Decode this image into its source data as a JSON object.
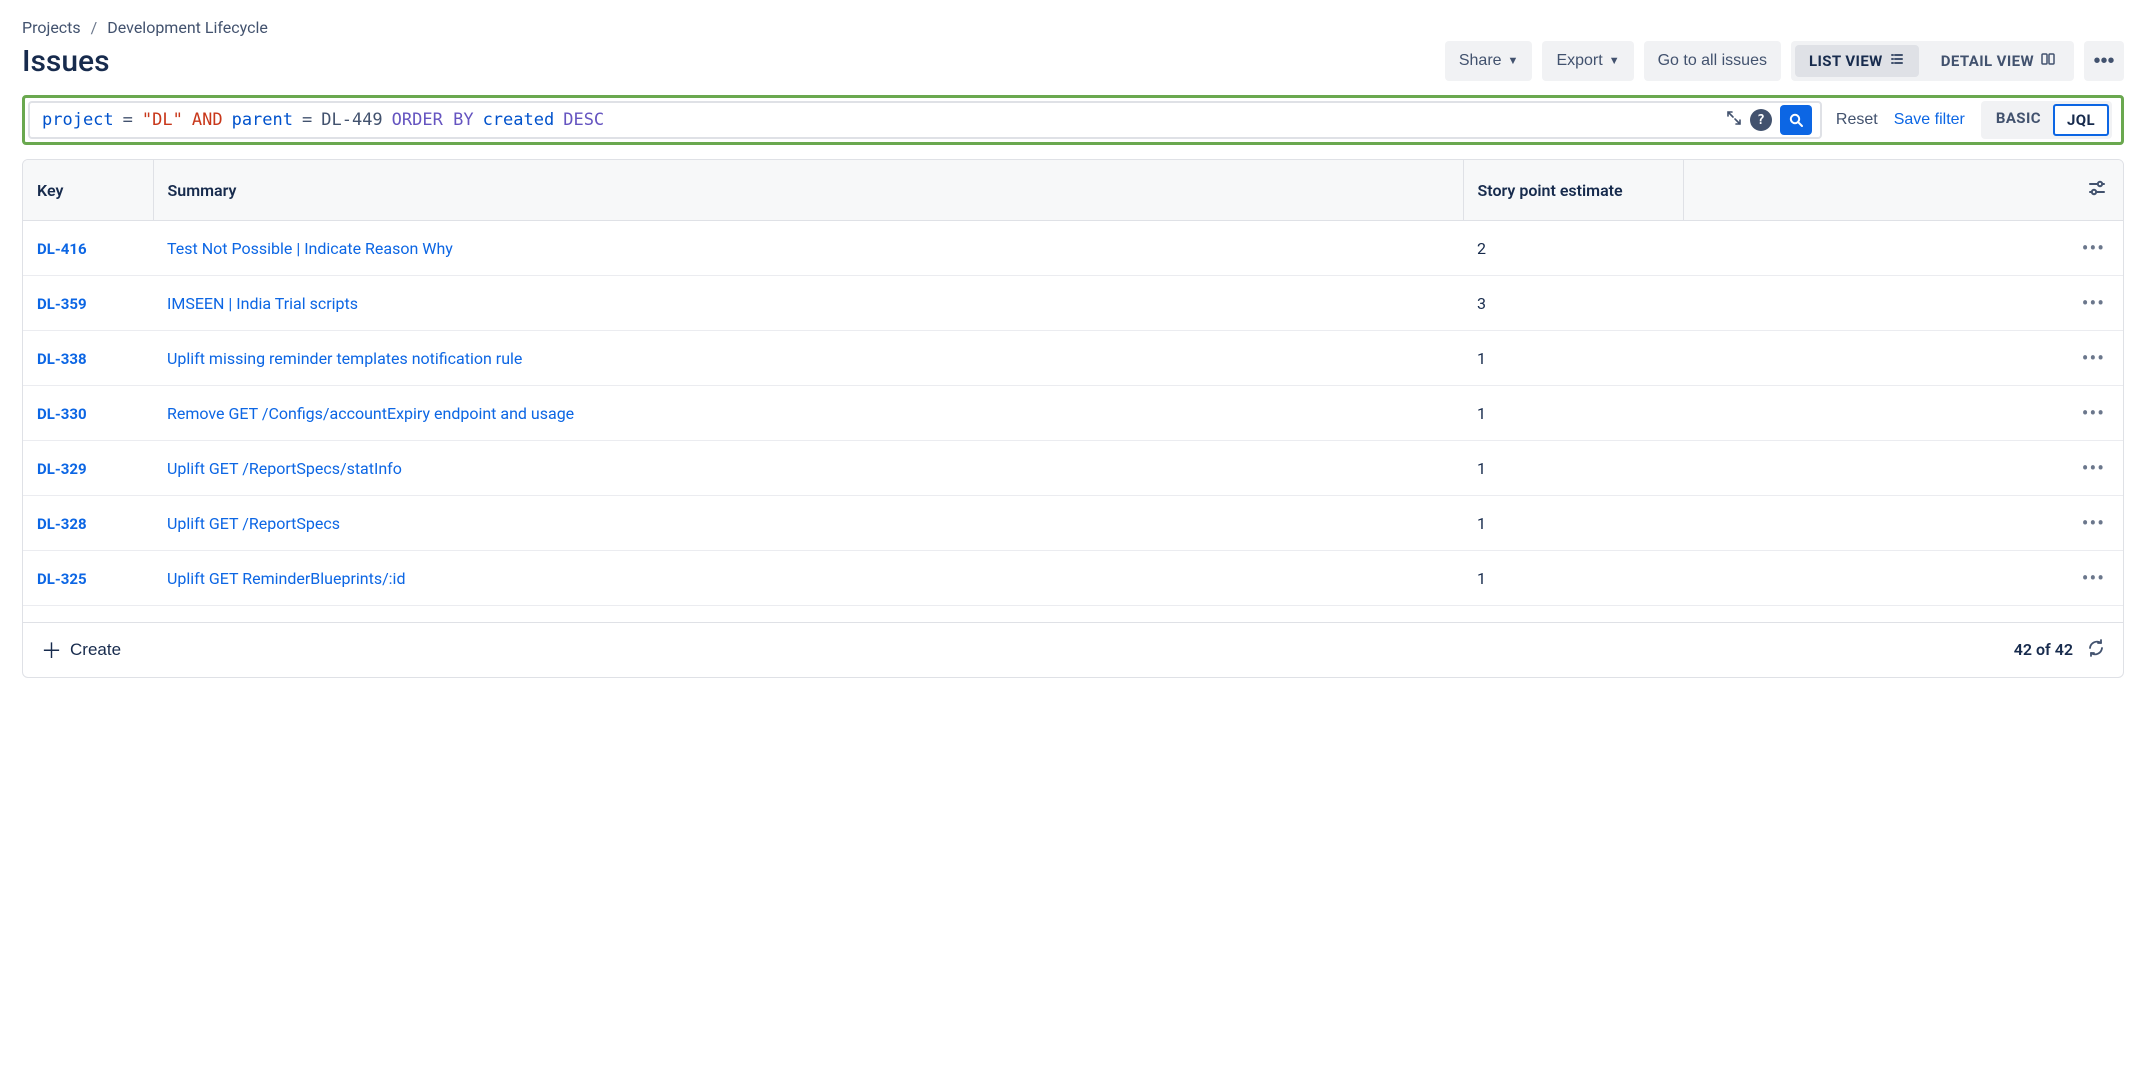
{
  "breadcrumb": {
    "root": "Projects",
    "current": "Development Lifecycle"
  },
  "title": "Issues",
  "header": {
    "share": "Share",
    "export": "Export",
    "go_all": "Go to all issues",
    "list_view": "LIST VIEW",
    "detail_view": "DETAIL VIEW"
  },
  "jql": {
    "t1": "project",
    "t2": "=",
    "t3": "\"DL\"",
    "t4": "AND",
    "t5": "parent",
    "t6": "=",
    "t7": "DL-449",
    "t8": "ORDER BY",
    "t9": "created",
    "t10": "DESC"
  },
  "search_right": {
    "reset": "Reset",
    "save": "Save filter",
    "basic": "BASIC",
    "jql": "JQL"
  },
  "columns": {
    "key": "Key",
    "summary": "Summary",
    "sp": "Story point estimate"
  },
  "rows": [
    {
      "key": "DL-416",
      "summary": "Test Not Possible | Indicate Reason Why",
      "sp": "2"
    },
    {
      "key": "DL-359",
      "summary": "IMSEEN | India Trial scripts",
      "sp": "3"
    },
    {
      "key": "DL-338",
      "summary": "Uplift missing reminder templates notification rule",
      "sp": "1"
    },
    {
      "key": "DL-330",
      "summary": "Remove GET /Configs/accountExpiry endpoint and usage",
      "sp": "1"
    },
    {
      "key": "DL-329",
      "summary": "Uplift GET /ReportSpecs/statInfo",
      "sp": "1"
    },
    {
      "key": "DL-328",
      "summary": "Uplift GET /ReportSpecs",
      "sp": "1"
    },
    {
      "key": "DL-325",
      "summary": "Uplift GET ReminderBlueprints/:id",
      "sp": "1"
    }
  ],
  "footer": {
    "create": "Create",
    "count": "42 of 42"
  }
}
